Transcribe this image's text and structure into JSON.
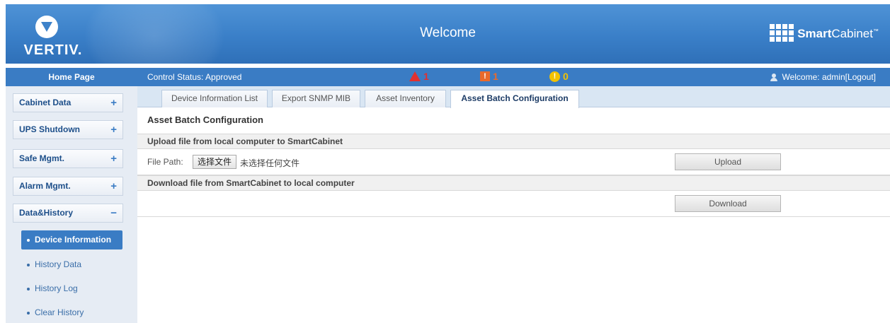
{
  "header": {
    "brand": "VERTIV.",
    "title": "Welcome",
    "product_name_bold": "Smart",
    "product_name_rest": "Cabinet",
    "product_tm": "™"
  },
  "sidebar": {
    "home_label": "Home Page",
    "menu": [
      {
        "label": "Cabinet Data",
        "toggle": "+"
      },
      {
        "label": "UPS Shutdown",
        "toggle": "+"
      },
      {
        "label": "Safe Mgmt.",
        "toggle": "+"
      },
      {
        "label": "Alarm Mgmt.",
        "toggle": "+"
      },
      {
        "label": "Data&History",
        "toggle": "−"
      }
    ],
    "submenu": [
      {
        "label": "Device Information",
        "active": true
      },
      {
        "label": "History Data",
        "active": false
      },
      {
        "label": "History Log",
        "active": false
      },
      {
        "label": "Clear History",
        "active": false
      }
    ]
  },
  "status": {
    "control_status": "Control Status:  Approved",
    "critical_count": "1",
    "major_count": "1",
    "minor_count": "0",
    "welcome": "Welcome: admin[Logout]",
    "colors": {
      "critical": "#e03030",
      "major": "#e96a2c",
      "minor": "#f2c200"
    }
  },
  "tabs": [
    {
      "label": "Device Information List",
      "active": false
    },
    {
      "label": "Export SNMP MIB",
      "active": false
    },
    {
      "label": "Asset Inventory",
      "active": false
    },
    {
      "label": "Asset Batch Configuration",
      "active": true
    }
  ],
  "content": {
    "page_title": "Asset Batch Configuration",
    "upload_section": "Upload file from local computer to SmartCabinet",
    "file_path_label": "File Path:",
    "choose_file": "选择文件",
    "no_file": "未选择任何文件",
    "upload_button": "Upload",
    "download_section": "Download file from SmartCabinet to local computer",
    "download_button": "Download"
  },
  "icons": {
    "critical": "warning-triangle-icon",
    "major": "exclamation-box-icon",
    "minor": "exclamation-circle-icon",
    "user": "user-icon"
  }
}
